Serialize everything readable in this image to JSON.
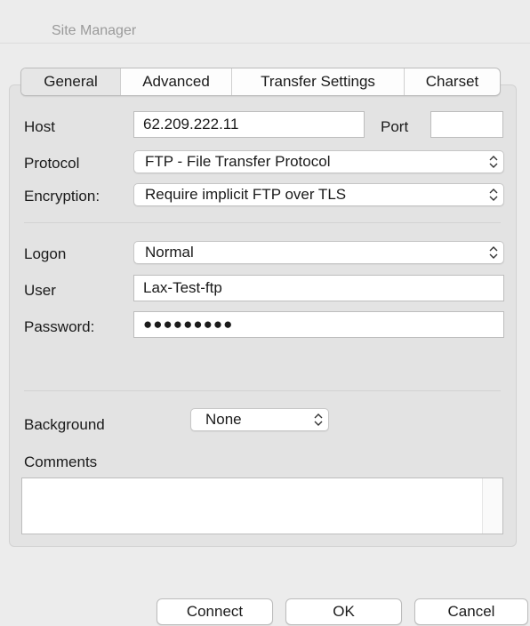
{
  "window": {
    "title": "Site Manager"
  },
  "tabs": [
    {
      "label": "General",
      "active": true
    },
    {
      "label": "Advanced",
      "active": false
    },
    {
      "label": "Transfer Settings",
      "active": false
    },
    {
      "label": "Charset",
      "active": false
    }
  ],
  "general": {
    "host_label": "Host",
    "host_value": "62.209.222.11",
    "port_label": "Port",
    "port_value": "",
    "protocol_label": "Protocol",
    "protocol_value": "FTP - File Transfer Protocol",
    "encryption_label": "Encryption:",
    "encryption_value": "Require implicit FTP over TLS",
    "logon_label": "Logon",
    "logon_value": "Normal",
    "user_label": "User",
    "user_value": "Lax-Test-ftp",
    "password_label": "Password:",
    "password_value": "●●●●●●●●●",
    "background_label": "Background",
    "background_value": "None",
    "comments_label": "Comments",
    "comments_value": ""
  },
  "buttons": {
    "connect": "Connect",
    "ok": "OK",
    "cancel": "Cancel"
  },
  "icons": {
    "select_chevron": "up-down-chevron-icon"
  }
}
